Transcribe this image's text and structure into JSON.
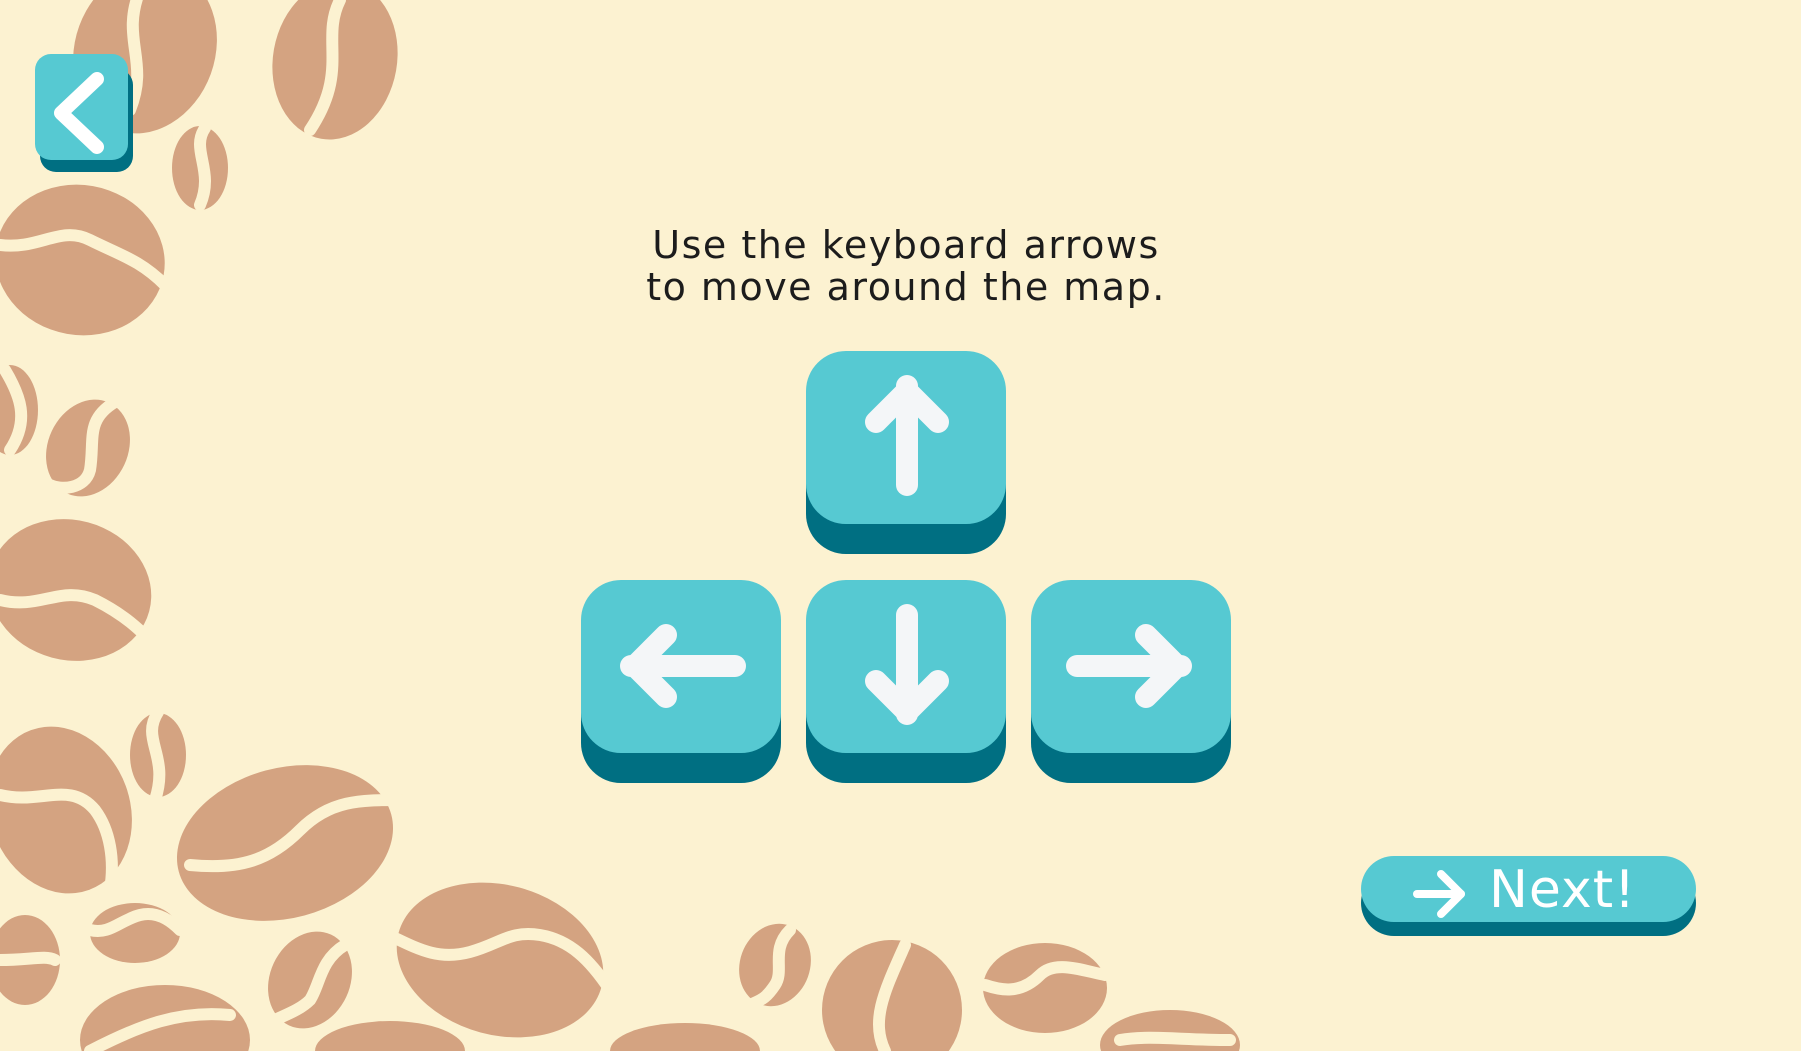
{
  "instructions": {
    "line1": "Use the keyboard arrows",
    "line2": "to move around the map."
  },
  "next_button": {
    "label": "Next!"
  },
  "colors": {
    "background": "#fcf2d1",
    "key_face": "#56c9d2",
    "key_shadow": "#006f82",
    "bean": "#d4a381",
    "arrow": "#f4f6f8"
  },
  "icons": {
    "back": "chevron-left-icon",
    "up": "arrow-up-icon",
    "left": "arrow-left-icon",
    "down": "arrow-down-icon",
    "right": "arrow-right-icon",
    "next": "arrow-right-icon"
  }
}
